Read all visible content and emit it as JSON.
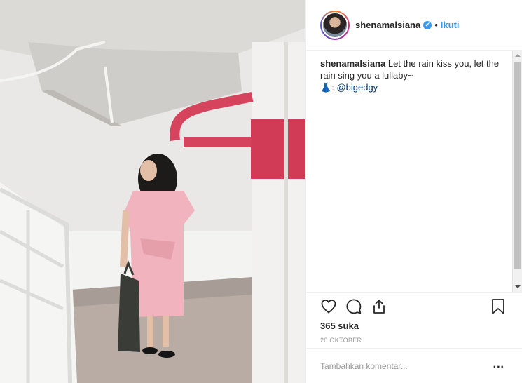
{
  "header": {
    "username": "shenamalsiana",
    "verified_glyph": "✔",
    "separator": "•",
    "follow_label": "Ikuti"
  },
  "caption": {
    "username": "shenamalsiana",
    "text_line1": "Let the rain kiss you, let the",
    "text_line2": "rain sing you a lullaby~",
    "dress_glyph": "👗",
    "credit_prefix": ":",
    "mention": "@bigedgy"
  },
  "actions": {
    "like_icon": "heart-icon",
    "comment_icon": "comment-icon",
    "share_icon": "share-icon",
    "save_icon": "bookmark-icon"
  },
  "likes": "365 suka",
  "date": "20 OKTOBER",
  "add_comment": {
    "placeholder": "Tambahkan komentar...",
    "more": "..."
  },
  "colors": {
    "accent": "#3897f0",
    "pink_pipe": "#d6435d",
    "dress": "#f1b3bd"
  }
}
